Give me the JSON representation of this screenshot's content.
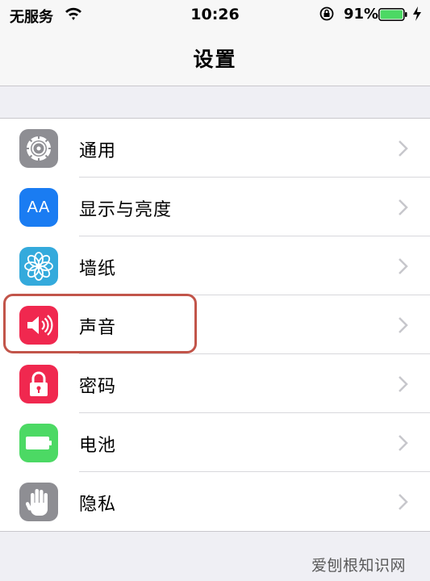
{
  "status_bar": {
    "carrier": "无服务",
    "time": "10:26",
    "battery_percent": "91%",
    "battery_level": 0.91
  },
  "nav": {
    "title": "设置"
  },
  "settings": [
    {
      "label": "通用",
      "icon": "gear-icon",
      "color": "#8e8e93"
    },
    {
      "label": "显示与亮度",
      "icon": "display-brightness-icon",
      "color": "#1a7cf2",
      "icon_text": "AA"
    },
    {
      "label": "墙纸",
      "icon": "wallpaper-flower-icon",
      "color": "#34aadc"
    },
    {
      "label": "声音",
      "icon": "speaker-icon",
      "color": "#f0284f"
    },
    {
      "label": "密码",
      "icon": "lock-icon",
      "color": "#f0284f"
    },
    {
      "label": "电池",
      "icon": "battery-icon",
      "color": "#4cd964"
    },
    {
      "label": "隐私",
      "icon": "hand-icon",
      "color": "#8e8e93"
    }
  ],
  "watermark": "爱刨根知识网"
}
